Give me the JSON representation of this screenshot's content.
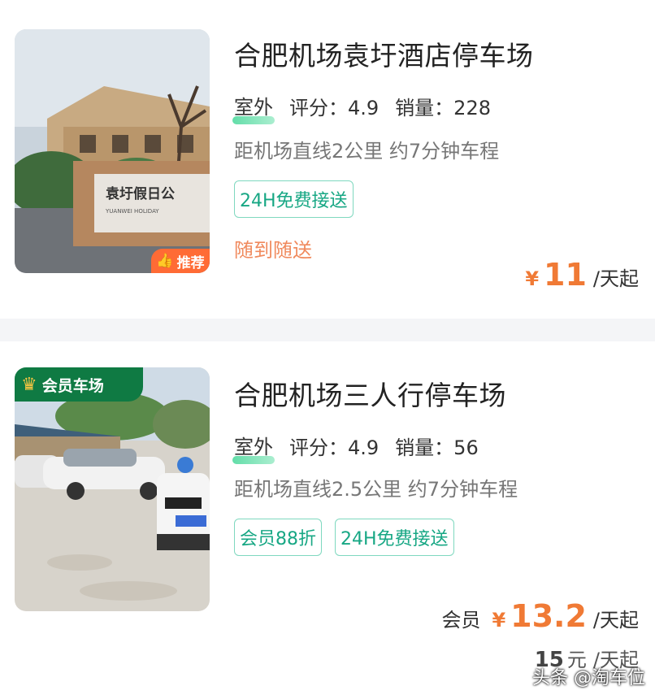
{
  "listings": [
    {
      "title": "合肥机场袁圩酒店停车场",
      "location_type": "室外",
      "rating_label": "评分：4.9",
      "sales_label": "销量：228",
      "distance": "距机场直线2公里 约7分钟车程",
      "tags": [
        "24H免费接送"
      ],
      "extra_note": "随到随送",
      "badge": "推荐",
      "badge_icon": "thumbs-up-icon",
      "photo_sign_text": "袁圩假日公",
      "photo_sign_subtext": "YUANWEI HOLIDAY",
      "price": {
        "currency": "¥",
        "amount": "11",
        "unit": "/天起"
      }
    },
    {
      "title": "合肥机场三人行停车场",
      "location_type": "室外",
      "rating_label": "评分：4.9",
      "sales_label": "销量：56",
      "distance": "距机场直线2.5公里 约7分钟车程",
      "tags": [
        "会员88折",
        "24H免费接送"
      ],
      "badge": "会员车场",
      "badge_icon": "crown-icon",
      "price_member": {
        "label": "会员",
        "currency": "¥",
        "amount": "13.2",
        "unit": "/天起"
      },
      "price_regular": {
        "amount": "15",
        "currency_word": "元",
        "unit": "/天起"
      }
    }
  ],
  "watermark": "头条 @淘车位",
  "colors": {
    "accent_orange": "#f07a35",
    "tag_green": "#17a784",
    "member_green": "#0f7a43",
    "recommend_orange": "#ff6b35"
  }
}
